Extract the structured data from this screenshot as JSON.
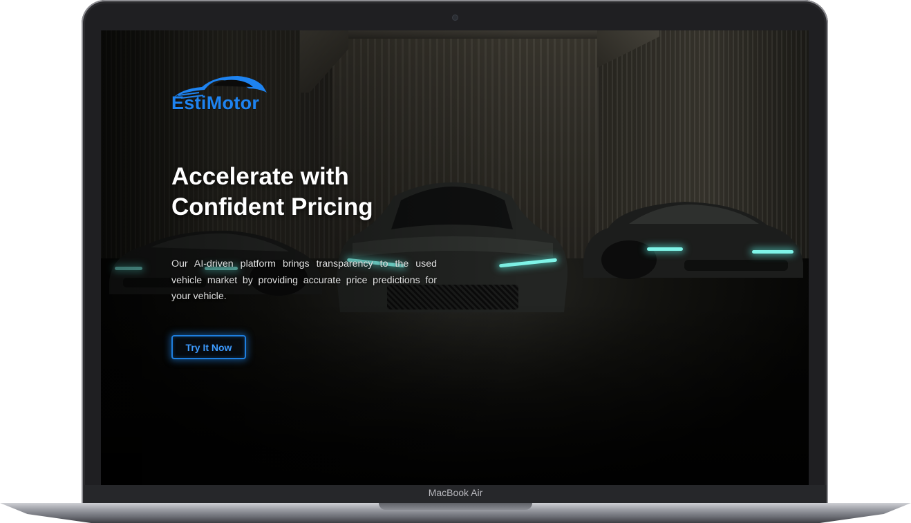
{
  "device": {
    "model_label": "MacBook Air"
  },
  "brand": {
    "name": "EstiMotor",
    "accent_color": "#1e83f0",
    "logo_icon": "car-silhouette-icon"
  },
  "hero": {
    "title_line1": "Accelerate with",
    "title_line2": "Confident Pricing",
    "description": "Our AI-driven platform brings transparency to the used vehicle market by providing accurate price predictions for your vehicle.",
    "cta_label": "Try It Now"
  },
  "background": {
    "scene": "dark garage with three sports cars"
  }
}
